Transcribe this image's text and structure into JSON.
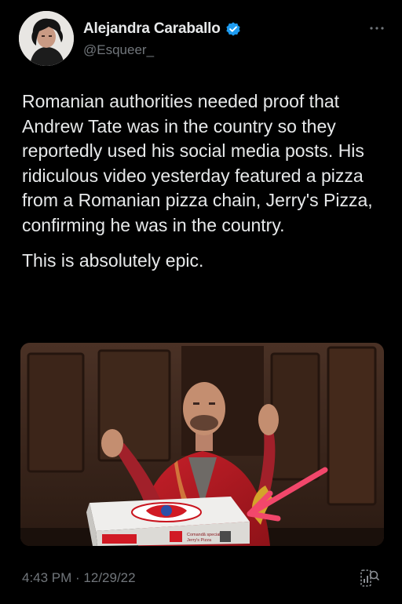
{
  "tweet": {
    "author": {
      "display_name": "Alejandra Caraballo",
      "handle": "@Esqueer_",
      "verified": true
    },
    "paragraphs": [
      "Romanian authorities needed proof that Andrew Tate was in the country so they reportedly used his social media posts. His ridiculous video yesterday featured a pizza from a Romanian pizza chain, Jerry's Pizza, confirming he was in the country.",
      "This is absolutely epic."
    ],
    "timestamp": "4:43 PM · 12/29/22"
  },
  "media": {
    "box_lines": [
      "Comandă specială",
      "Jerry's Pizza"
    ]
  },
  "colors": {
    "background": "#000000",
    "text_primary": "#e7e9ea",
    "text_secondary": "#71767b",
    "verified_badge": "#1d9bf0",
    "annotation_arrow": "#f2476b"
  },
  "icons": {
    "verified": "verified-badge-icon",
    "more": "more-options-icon",
    "analytics": "analytics-icon"
  }
}
